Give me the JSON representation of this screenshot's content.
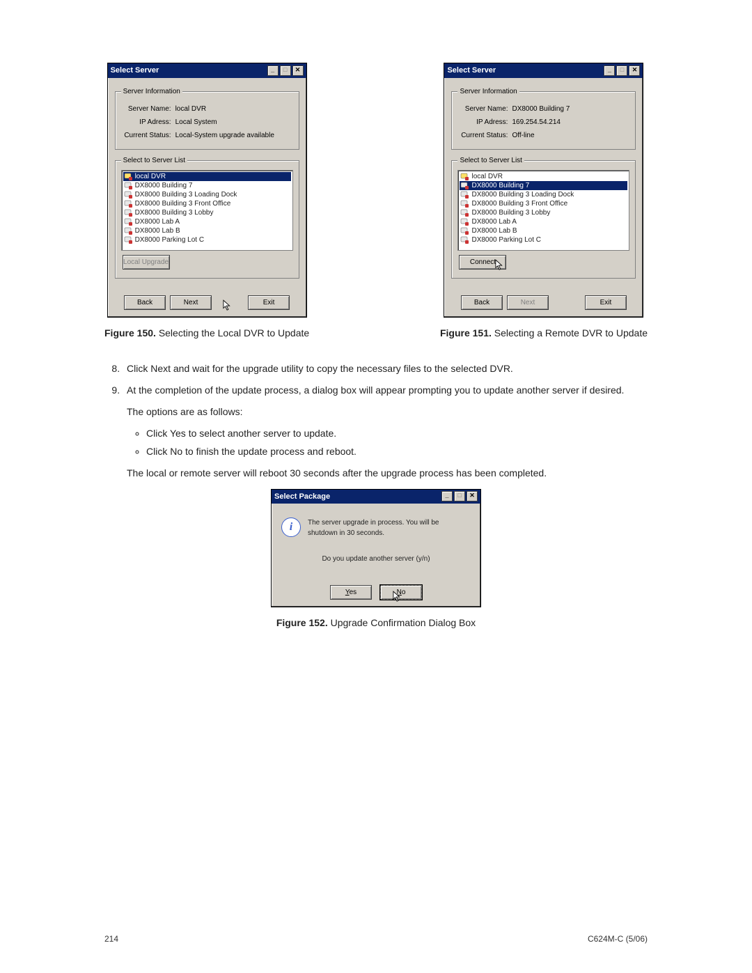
{
  "dialog_title": "Select Server",
  "group_server_info": "Server Information",
  "group_server_list": "Select to Server List",
  "labels": {
    "server_name": "Server Name:",
    "ip_adress": "IP Adress:",
    "current_status": "Current Status:"
  },
  "server_items": [
    "local DVR",
    "DX8000 Building 7",
    "DX8000 Building 3 Loading Dock",
    "DX8000 Building 3 Front Office",
    "DX8000 Building 3 Lobby",
    "DX8000 Lab A",
    "DX8000 Lab B",
    "DX8000 Parking Lot C"
  ],
  "buttons": {
    "local_upgrade": "Local Upgrade",
    "connect": "Connect",
    "back": "Back",
    "next": "Next",
    "exit": "Exit",
    "yes": "Yes",
    "no": "No"
  },
  "left": {
    "server_name_val": "local DVR",
    "ip_val": "Local System",
    "status_val": "Local-System upgrade available",
    "selected_index": 0,
    "action_enabled": false
  },
  "right": {
    "server_name_val": "DX8000 Building 7",
    "ip_val": "169.254.54.214",
    "status_val": "Off-line",
    "selected_index": 1,
    "next_disabled": true
  },
  "captions": {
    "fig150_label": "Figure 150.",
    "fig150_text": "Selecting the Local DVR to Update",
    "fig151_label": "Figure 151.",
    "fig151_text": "Selecting a Remote DVR to Update",
    "fig152_label": "Figure 152.",
    "fig152_text": "Upgrade Confirmation Dialog Box"
  },
  "steps": {
    "start": 8,
    "s8": "Click Next and wait for the upgrade utility to copy the necessary files to the selected DVR.",
    "s9a": "At the completion of the update process, a dialog box will appear prompting you to update another server if desired.",
    "s9b": "The options are as follows:",
    "s9_bullets": [
      "Click Yes to select another server to update.",
      "Click No to finish the update process and reboot."
    ],
    "s9c": "The local or remote server will reboot 30 seconds after the upgrade process has been completed."
  },
  "modal": {
    "title": "Select Package",
    "msg": "The server upgrade in process. You will be shutdown in 30 seconds.",
    "prompt": "Do you update another server (y/n)"
  },
  "footer": {
    "page": "214",
    "doc": "C624M-C (5/06)"
  }
}
